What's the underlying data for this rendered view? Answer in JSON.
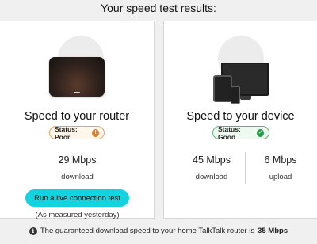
{
  "title": "Your speed test results:",
  "router_card": {
    "heading": "Speed to your router",
    "status_label": "Status: Poor",
    "status_icon": "exclamation-icon",
    "speed": "29 Mbps",
    "speed_caption": "download",
    "button_label": "Run a live connection test",
    "note": "(As measured yesterday)"
  },
  "device_card": {
    "heading": "Speed to your device",
    "status_label": "Status: Good",
    "status_icon": "checkmark-icon",
    "download_speed": "45 Mbps",
    "download_caption": "download",
    "upload_speed": "6 Mbps",
    "upload_caption": "upload"
  },
  "footer": {
    "text": "The guaranteed download speed to your home TalkTalk router is",
    "guaranteed_speed": "35 Mbps"
  },
  "colors": {
    "accent_button": "#12d4e0",
    "status_poor": "#e07a1f",
    "status_good": "#2c9a4b"
  }
}
